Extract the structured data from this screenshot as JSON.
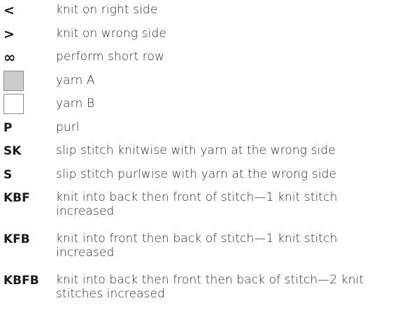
{
  "legend": {
    "items": [
      {
        "symbol": "<",
        "description": "knit on right side"
      },
      {
        "symbol": ">",
        "description": "knit on wrong side"
      },
      {
        "symbol": "∞",
        "description": "perform short row"
      },
      {
        "swatch_color": "#cccccc",
        "description": "yarn A"
      },
      {
        "swatch_color": "#ffffff",
        "description": "yarn B"
      },
      {
        "symbol": "P",
        "description": "purl"
      },
      {
        "symbol": "SK",
        "description": "slip stitch knitwise with yarn at the wrong side"
      },
      {
        "symbol": "S",
        "description": "slip stitch purlwise with yarn at the wrong side"
      },
      {
        "symbol": "KBF",
        "description": "knit into back then front of stitch—1 knit stitch increased"
      },
      {
        "symbol": "KFB",
        "description": "knit into front then back of stitch—1 knit stitch increased"
      },
      {
        "symbol": "KBFB",
        "description": "knit into back then front then back of stitch—2 knit stitches increased"
      }
    ]
  }
}
